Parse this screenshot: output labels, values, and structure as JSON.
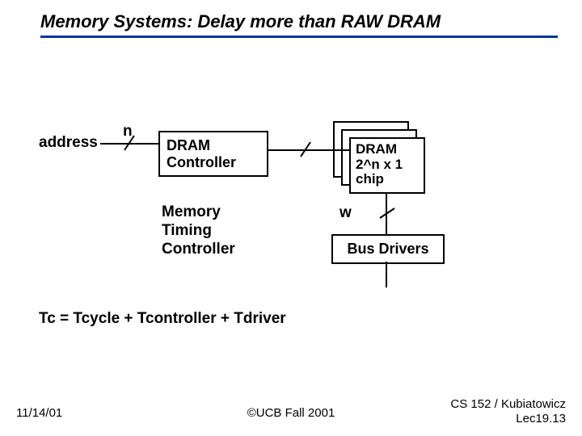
{
  "title": "Memory Systems: Delay more than RAW DRAM",
  "address_label": "address",
  "n_label": "n",
  "dram_controller": "DRAM\nController",
  "dram_chip": "DRAM\n2^n x 1\nchip",
  "memory_timing": "Memory\nTiming\nController",
  "w_label": "w",
  "bus_drivers": "Bus Drivers",
  "equation": "Tc = Tcycle + Tcontroller + Tdriver",
  "footer": {
    "date": "11/14/01",
    "copyright": "©UCB Fall 2001",
    "course_line1": "CS 152 / Kubiatowicz",
    "course_line2": "Lec19.13"
  }
}
